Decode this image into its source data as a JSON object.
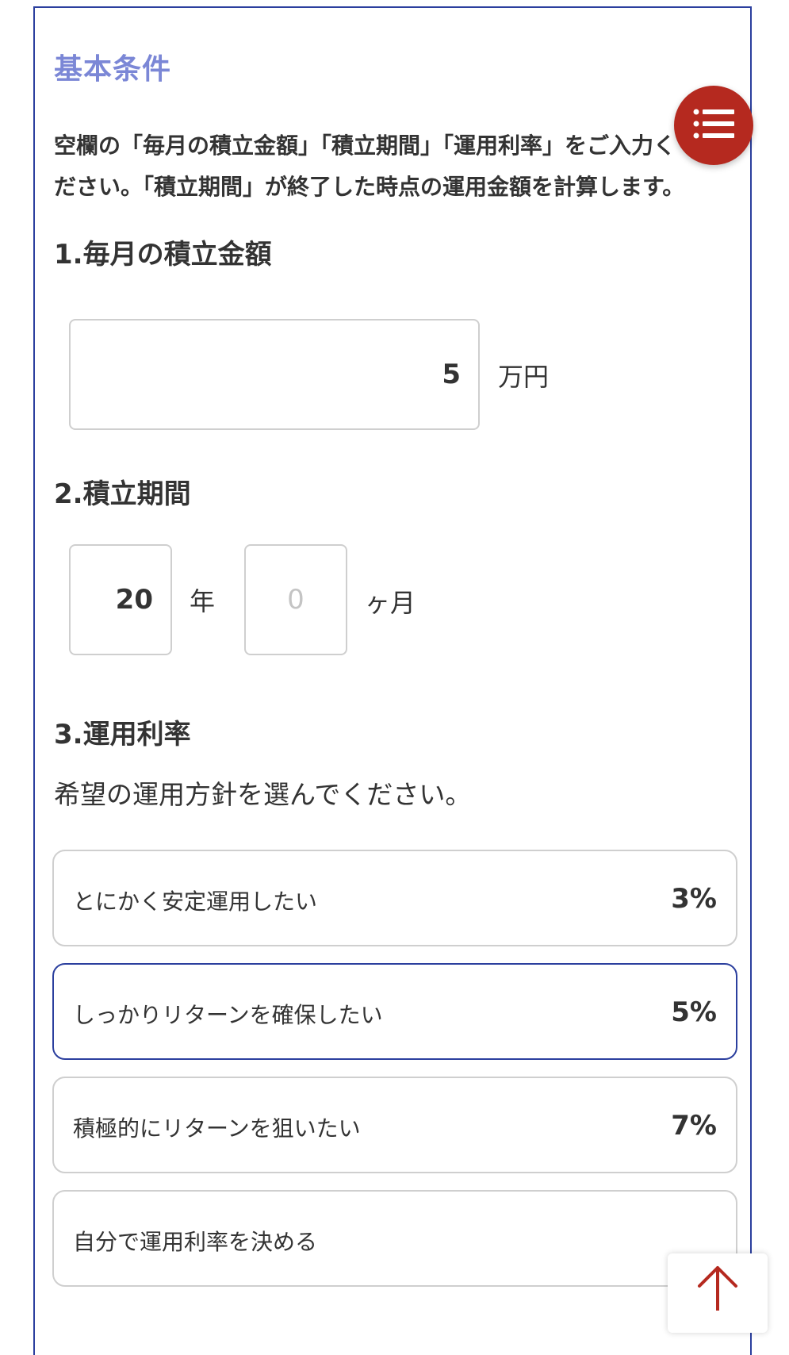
{
  "section": {
    "heading": "基本条件",
    "intro_line1": "空欄の「毎月の積立金額」「積立期間」「運用利率」をご入力く",
    "intro_line2": "ださい。「積立期間」が終了した時点の運用金額を計算します。"
  },
  "q1": {
    "label": "1.毎月の積立金額",
    "value": "5",
    "unit": "万円"
  },
  "q2": {
    "label": "2.積立期間",
    "years_value": "20",
    "years_unit": "年",
    "months_placeholder": "0",
    "months_unit": "ヶ月"
  },
  "q3": {
    "label": "3.運用利率",
    "hint": "希望の運用方針を選んでください。",
    "options": [
      {
        "label": "とにかく安定運用したい",
        "rate": "3%",
        "selected": false
      },
      {
        "label": "しっかりリターンを確保したい",
        "rate": "5%",
        "selected": true
      },
      {
        "label": "積極的にリターンを狙いたい",
        "rate": "7%",
        "selected": false
      },
      {
        "label": "自分で運用利率を決める",
        "rate": "",
        "selected": false
      }
    ]
  },
  "icons": {
    "menu": "list-menu-icon",
    "scroll_top": "arrow-up-icon"
  },
  "colors": {
    "frame_border": "#2b3f9e",
    "heading": "#7b87d6",
    "fab": "#b5291f",
    "selected_border": "#2b3f9e"
  }
}
